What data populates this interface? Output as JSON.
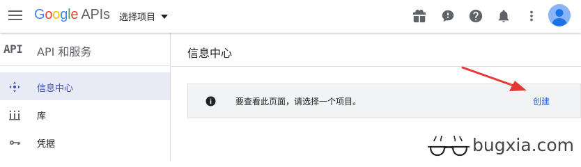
{
  "header": {
    "logo_text_parts": [
      "G",
      "o",
      "o",
      "g",
      "l",
      "e"
    ],
    "logo_suffix": "APIs",
    "project_selector": "选择项目",
    "icons": [
      "gift-icon",
      "feedback-icon",
      "help-icon",
      "notifications-icon",
      "more-vert-icon",
      "account-icon"
    ]
  },
  "sidebar": {
    "logo": "API",
    "title": "API 和服务",
    "items": [
      {
        "label": "信息中心",
        "icon": "dashboard-icon",
        "active": true
      },
      {
        "label": "库",
        "icon": "library-icon",
        "active": false
      },
      {
        "label": "凭据",
        "icon": "key-icon",
        "active": false
      }
    ]
  },
  "main": {
    "title": "信息中心",
    "notice": {
      "icon": "info-icon",
      "message": "要查看此页面，请选择一个项目。",
      "action": "创建"
    }
  },
  "watermark": {
    "text": "bugxia.com"
  },
  "colors": {
    "accent": "#3f51b5",
    "link": "#3367d6",
    "active_bg": "#e8eaf6",
    "annotation_arrow": "#e53935"
  }
}
